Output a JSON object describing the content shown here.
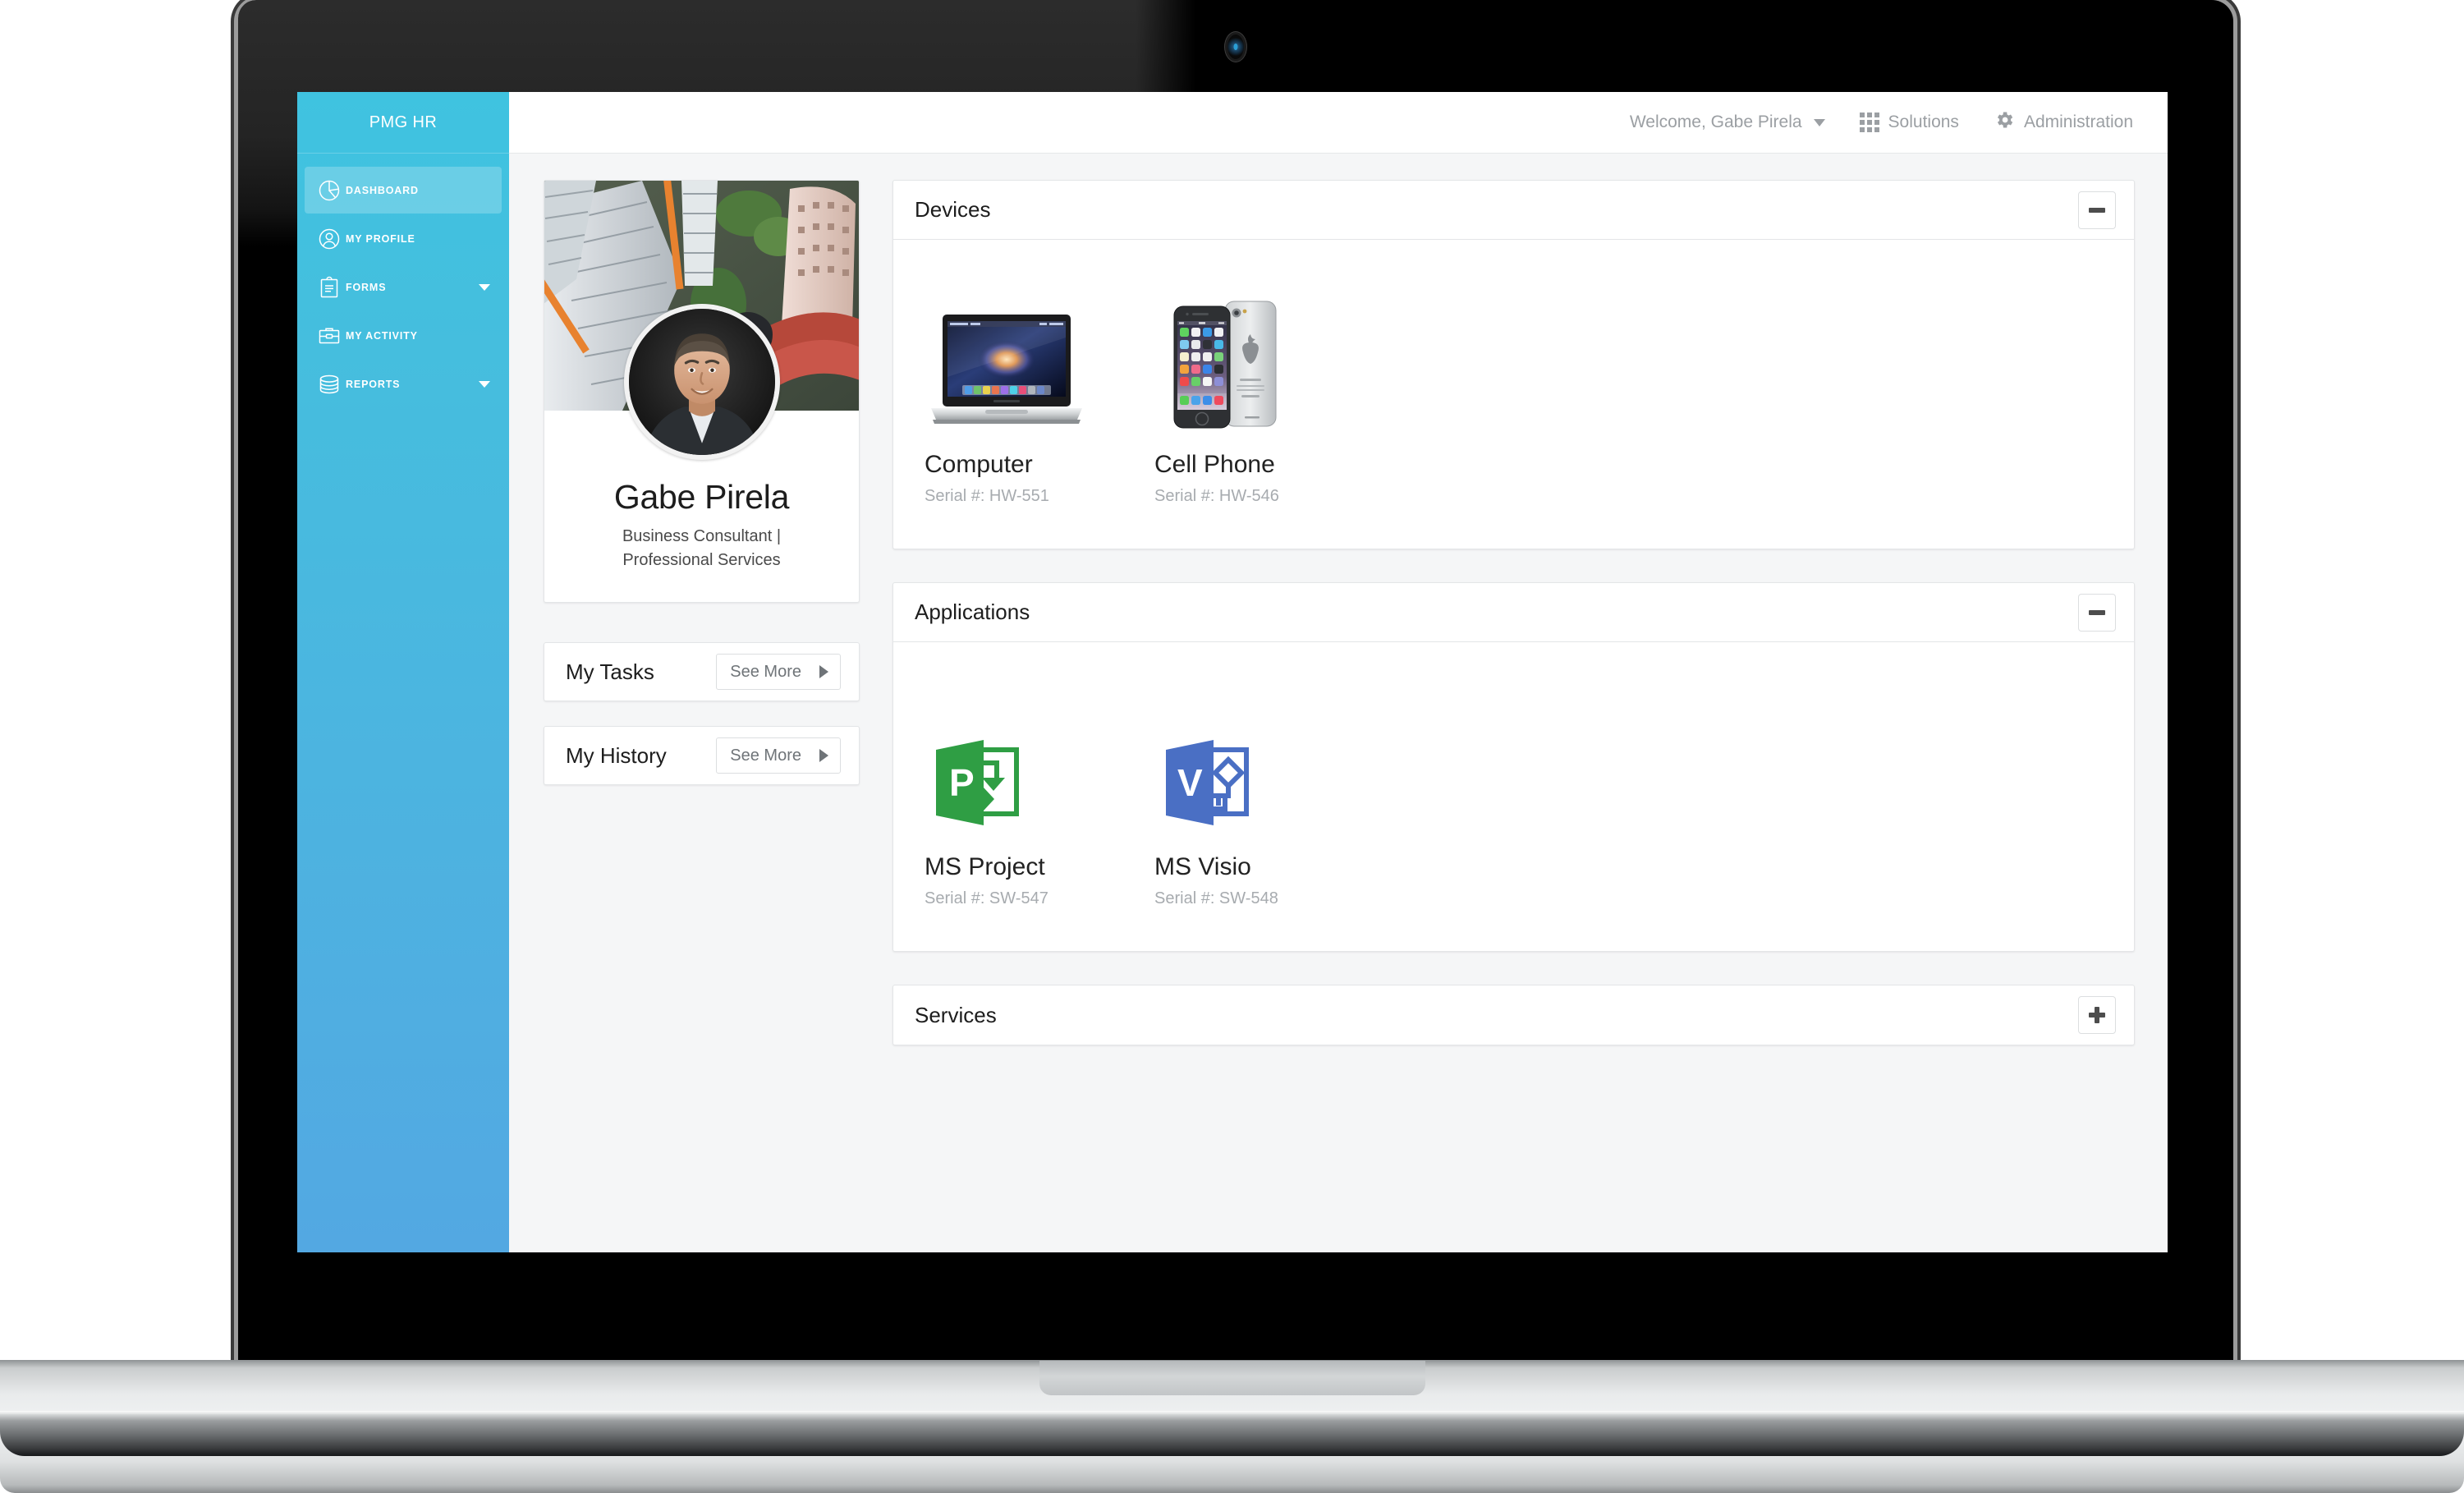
{
  "sidebar": {
    "brand": "PMG HR",
    "items": [
      {
        "label": "DASHBOARD",
        "icon": "pie-chart-icon",
        "active": true,
        "caret": false
      },
      {
        "label": "MY PROFILE",
        "icon": "user-circle-icon",
        "active": false,
        "caret": false
      },
      {
        "label": "FORMS",
        "icon": "clipboard-icon",
        "active": false,
        "caret": true
      },
      {
        "label": "MY ACTIVITY",
        "icon": "briefcase-icon",
        "active": false,
        "caret": false
      },
      {
        "label": "REPORTS",
        "icon": "database-icon",
        "active": false,
        "caret": true
      }
    ]
  },
  "topbar": {
    "welcome": "Welcome, Gabe Pirela",
    "solutions": "Solutions",
    "administration": "Administration"
  },
  "profile": {
    "name": "Gabe Pirela",
    "title": "Business Consultant | Professional Services"
  },
  "tasks": {
    "title": "My Tasks",
    "see_more": "See More"
  },
  "history": {
    "title": "My History",
    "see_more": "See More"
  },
  "panels": [
    {
      "title": "Devices",
      "collapsed": false,
      "toggle": "minus",
      "items": [
        {
          "name": "Computer",
          "serial": "Serial #: HW-551",
          "art": "macbook-image"
        },
        {
          "name": "Cell Phone",
          "serial": "Serial #: HW-546",
          "art": "iphone-image"
        }
      ]
    },
    {
      "title": "Applications",
      "collapsed": false,
      "toggle": "minus",
      "items": [
        {
          "name": "MS Project",
          "serial": "Serial #: SW-547",
          "art": "ms-project-icon"
        },
        {
          "name": "MS Visio",
          "serial": "Serial #: SW-548",
          "art": "ms-visio-icon"
        }
      ]
    },
    {
      "title": "Services",
      "collapsed": true,
      "toggle": "plus",
      "items": []
    }
  ],
  "colors": {
    "sidebar_top": "#3fc3e0",
    "sidebar_bottom": "#53a8e2",
    "content_bg": "#f5f6f7",
    "muted_text": "#a7abaf",
    "ms_project_green": "#2f9e44",
    "ms_visio_blue": "#4a6fc4"
  }
}
